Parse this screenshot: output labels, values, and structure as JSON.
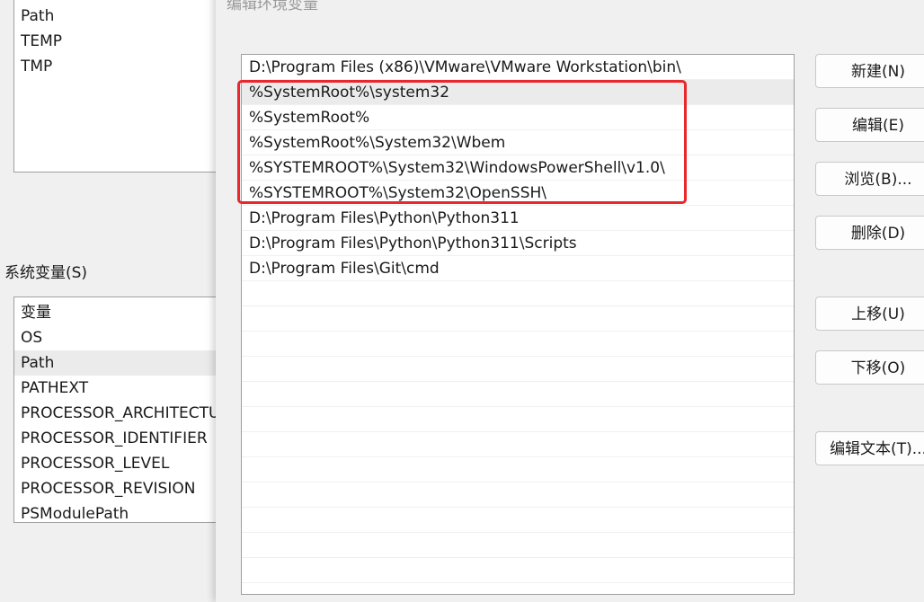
{
  "user_vars": {
    "items": [
      "Path",
      "TEMP",
      "TMP"
    ]
  },
  "system_vars": {
    "label": "系统变量(S)",
    "header": "变量",
    "items": [
      "OS",
      "Path",
      "PATHEXT",
      "PROCESSOR_ARCHITECTU",
      "PROCESSOR_IDENTIFIER",
      "PROCESSOR_LEVEL",
      "PROCESSOR_REVISION",
      "PSModulePath"
    ]
  },
  "dialog": {
    "title": "编辑环境变量",
    "paths": [
      "D:\\Program Files (x86)\\VMware\\VMware Workstation\\bin\\",
      "%SystemRoot%\\system32",
      "%SystemRoot%",
      "%SystemRoot%\\System32\\Wbem",
      "%SYSTEMROOT%\\System32\\WindowsPowerShell\\v1.0\\",
      "%SYSTEMROOT%\\System32\\OpenSSH\\",
      "D:\\Program Files\\Python\\Python311",
      "D:\\Program Files\\Python\\Python311\\Scripts",
      "D:\\Program Files\\Git\\cmd"
    ],
    "buttons": {
      "new": "新建(N)",
      "edit": "编辑(E)",
      "browse": "浏览(B)...",
      "delete": "删除(D)",
      "move_up": "上移(U)",
      "move_down": "下移(O)",
      "edit_text": "编辑文本(T)..."
    }
  },
  "colors": {
    "highlight": "#e8282a"
  }
}
